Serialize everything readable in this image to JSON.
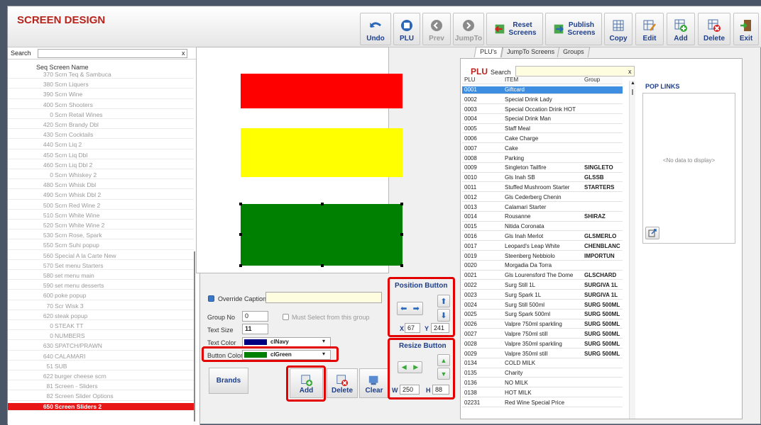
{
  "title": "SCREEN DESIGN",
  "toolbar": {
    "undo": "Undo",
    "plu": "PLU",
    "prev": "Prev",
    "jumpto": "JumpTo",
    "reset": "Reset\nScreens",
    "publish": "Publish\nScreens",
    "copy": "Copy",
    "edit": "Edit",
    "add": "Add",
    "delete": "Delete",
    "exit": "Exit"
  },
  "left": {
    "search_label": "Search",
    "clear": "x",
    "col_header": "Seq Screen Name",
    "items": [
      {
        "seq": "370",
        "name": "Scrn Teq & Sambuca"
      },
      {
        "seq": "380",
        "name": "Scrn Liquers"
      },
      {
        "seq": "390",
        "name": "Scrn Wine"
      },
      {
        "seq": "400",
        "name": "Scrn Shooters"
      },
      {
        "seq": "0",
        "name": "Scrn Retail Wines"
      },
      {
        "seq": "420",
        "name": "Scrn Brandy Dbl"
      },
      {
        "seq": "430",
        "name": "Scrn Cocktails"
      },
      {
        "seq": "440",
        "name": "Scrn Liq 2"
      },
      {
        "seq": "450",
        "name": "Scrn Liq Dbl"
      },
      {
        "seq": "460",
        "name": "Scrn Liq Dbl 2"
      },
      {
        "seq": "0",
        "name": "Scrn Whiskey 2"
      },
      {
        "seq": "480",
        "name": "Scrn Whisk Dbl"
      },
      {
        "seq": "490",
        "name": "Scrn Whisk Dbl 2"
      },
      {
        "seq": "500",
        "name": "Scrn Red Wine 2"
      },
      {
        "seq": "510",
        "name": "Scrn White Wine"
      },
      {
        "seq": "520",
        "name": "Scrn White Wine 2"
      },
      {
        "seq": "530",
        "name": "Scrn Rose, Spark"
      },
      {
        "seq": "550",
        "name": "Scrn Suhi popup"
      },
      {
        "seq": "560",
        "name": "Special A la Carte New"
      },
      {
        "seq": "570",
        "name": "Set menu Starters"
      },
      {
        "seq": "580",
        "name": "set menu main"
      },
      {
        "seq": "590",
        "name": "set menu desserts"
      },
      {
        "seq": "600",
        "name": "poke popup"
      },
      {
        "seq": "70",
        "name": "Scr Wisk 3"
      },
      {
        "seq": "620",
        "name": "steak popup"
      },
      {
        "seq": "0",
        "name": "STEAK TT"
      },
      {
        "seq": "0",
        "name": "NUMBERS"
      },
      {
        "seq": "630",
        "name": "SPATCH/PRAWN"
      },
      {
        "seq": "640",
        "name": "CALAMARI"
      },
      {
        "seq": "51",
        "name": "SUB"
      },
      {
        "seq": "622",
        "name": "burger cheese scrn"
      },
      {
        "seq": "81",
        "name": "Screen - Sliders"
      },
      {
        "seq": "82",
        "name": "Screen Slider Options"
      },
      {
        "seq": "650",
        "name": "Screen Sliders 2"
      }
    ]
  },
  "canvas": {
    "colors": [
      "#ff0000",
      "#ffff00",
      "#008000"
    ]
  },
  "props": {
    "override_caption": "Override Caption",
    "group_no_label": "Group No",
    "group_no": "0",
    "must_select": "Must Select from this group",
    "text_size_label": "Text Size",
    "text_size": "11",
    "text_color_label": "Text Color",
    "text_color": "clNavy",
    "text_color_hex": "#000080",
    "button_color_label": "Button Color",
    "button_color": "clGreen",
    "button_color_hex": "#008000",
    "brands": "Brands",
    "add": "Add",
    "delete": "Delete",
    "clear": "Clear"
  },
  "position": {
    "title": "Position Button",
    "x_label": "X",
    "x": "67",
    "y_label": "Y",
    "y": "241"
  },
  "resize": {
    "title": "Resize Button",
    "w_label": "W",
    "w": "250",
    "h_label": "H",
    "h": "88"
  },
  "right": {
    "tabs": [
      "PLU's",
      "JumpTo Screens",
      "Groups"
    ],
    "plu_label": "PLU",
    "search_label": "Search",
    "clear": "x",
    "headers": [
      "PLU",
      "ITEM",
      "Group"
    ],
    "rows": [
      [
        "0001",
        "Giftcard",
        ""
      ],
      [
        "0002",
        "Special Drink Lady",
        ""
      ],
      [
        "0003",
        "Special Occation Drink HOT",
        ""
      ],
      [
        "0004",
        "Special Drink Man",
        ""
      ],
      [
        "0005",
        "Staff Meal",
        ""
      ],
      [
        "0006",
        "Cake Charge",
        ""
      ],
      [
        "0007",
        "Cake",
        ""
      ],
      [
        "0008",
        "Parking",
        ""
      ],
      [
        "0009",
        "Singleton Tailfire",
        "SINGLETO"
      ],
      [
        "0010",
        "Gls Inah SB",
        "GLSSB"
      ],
      [
        "0011",
        "Stuffed Mushroom Starter",
        "STARTERS"
      ],
      [
        "0012",
        "Gls Cederberg Chenin",
        ""
      ],
      [
        "0013",
        "Calamari Starter",
        ""
      ],
      [
        "0014",
        "Rousanne",
        "SHIRAZ"
      ],
      [
        "0015",
        "Nitida Coronata",
        ""
      ],
      [
        "0016",
        "Gls Inah Merlot",
        "GLSMERLO"
      ],
      [
        "0017",
        "Leopard's Leap White",
        "CHENBLANC"
      ],
      [
        "0019",
        "Steenberg Nebbiolo",
        "IMPORTUN"
      ],
      [
        "0020",
        "Morgadia Da Torra",
        ""
      ],
      [
        "0021",
        "Gls Lourensford The Dome",
        "GLSCHARD"
      ],
      [
        "0022",
        "Surg Still 1L",
        "SURGIVA 1L"
      ],
      [
        "0023",
        "Surg Spark 1L",
        "SURGIVA 1L"
      ],
      [
        "0024",
        "Surg Still 500ml",
        "SURG 500ML"
      ],
      [
        "0025",
        "Surg Spark 500ml",
        "SURG 500ML"
      ],
      [
        "0026",
        "Valpre 750ml sparkling",
        "SURG 500ML"
      ],
      [
        "0027",
        "Valpre 750ml still",
        "SURG 500ML"
      ],
      [
        "0028",
        "Valpre 350ml sparkling",
        "SURG 500ML"
      ],
      [
        "0029",
        "Valpre 350ml still",
        "SURG 500ML"
      ],
      [
        "0134",
        "COLD MILK",
        ""
      ],
      [
        "0135",
        "Charity",
        ""
      ],
      [
        "0136",
        "NO MILK",
        ""
      ],
      [
        "0138",
        "HOT MILK",
        ""
      ],
      [
        "02231",
        "Red Wine Special Price",
        ""
      ]
    ],
    "pop_links": "POP LINKS",
    "no_data": "<No data to display>"
  }
}
